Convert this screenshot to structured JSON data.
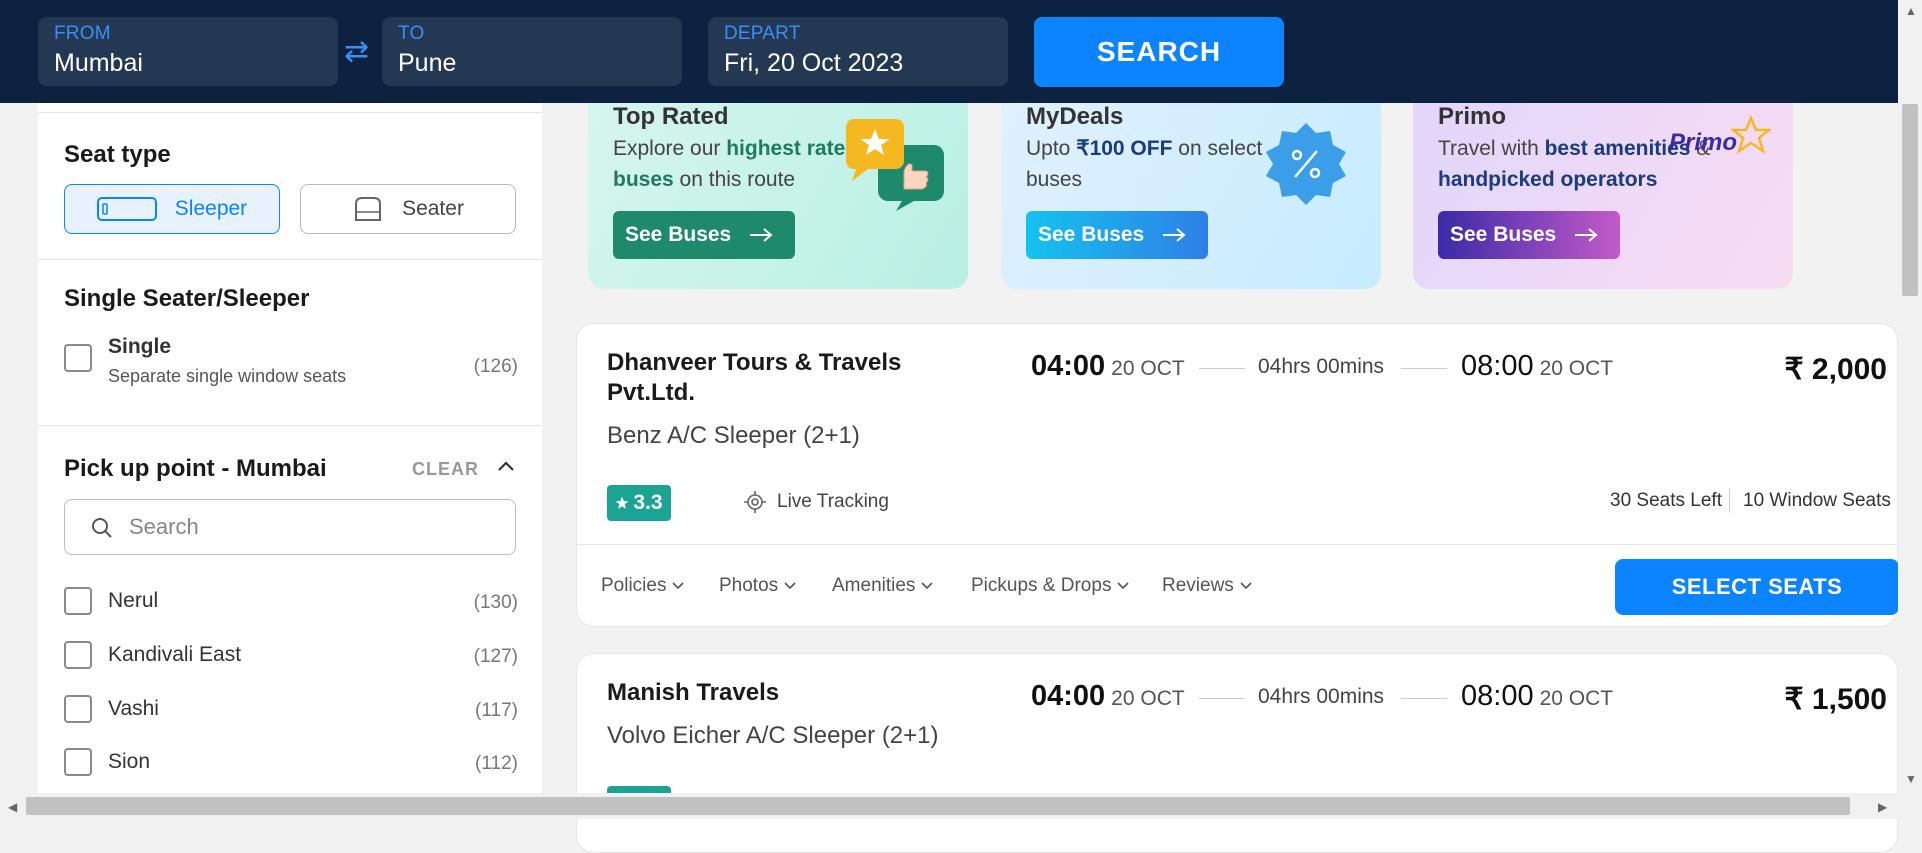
{
  "search": {
    "from_label": "FROM",
    "from_value": "Mumbai",
    "swap_icon": "⇄",
    "to_label": "TO",
    "to_value": "Pune",
    "depart_label": "DEPART",
    "depart_value": "Fri, 20 Oct 2023",
    "button_label": "SEARCH"
  },
  "filters": {
    "seat_type": {
      "title": "Seat type",
      "options": [
        {
          "label": "Sleeper",
          "active": true
        },
        {
          "label": "Seater",
          "active": false
        }
      ]
    },
    "single": {
      "title": "Single Seater/Sleeper",
      "option_label": "Single",
      "option_sub": "Separate single window seats",
      "option_count": "(126)"
    },
    "pickup": {
      "title": "Pick up point - Mumbai",
      "clear_label": "CLEAR",
      "search_placeholder": "Search",
      "items": [
        {
          "label": "Nerul",
          "count": "(130)"
        },
        {
          "label": "Kandivali East",
          "count": "(127)"
        },
        {
          "label": "Vashi",
          "count": "(117)"
        },
        {
          "label": "Sion",
          "count": "(112)"
        }
      ]
    }
  },
  "promos": [
    {
      "title": "Top Rated",
      "desc_pre": "Explore our ",
      "desc_bold": "highest rated buses",
      "desc_post": " on this route",
      "button": "See Buses",
      "color": "#1f8a6b",
      "bg": "#c9f3ea"
    },
    {
      "title": "MyDeals",
      "desc_pre": "Upto ",
      "desc_bold": "₹100 OFF",
      "desc_post": " on select buses",
      "button": "See Buses",
      "color": "#1fb6f0",
      "bg": "#d5eeff"
    },
    {
      "title": "Primo",
      "desc_pre": "Travel with ",
      "desc_bold": "best amenities",
      "desc_mid": " & ",
      "desc_bold2": "handpicked operators",
      "button": "See Buses",
      "logo_text": "Primo",
      "color": "#4b2aa8",
      "bg": "#ead9fb"
    }
  ],
  "buses": [
    {
      "operator": "Dhanveer Tours & Travels Pvt.Ltd.",
      "bus_type": "Benz A/C Sleeper (2+1)",
      "depart_time": "04:00",
      "depart_date": "20 OCT",
      "duration": "04hrs 00mins",
      "arrive_time": "08:00",
      "arrive_date": "20 OCT",
      "price": "₹ 2,000",
      "rating": "3.3",
      "tracking": "Live Tracking",
      "seats_left": "30 Seats Left",
      "window_seats": "10 Window Seats",
      "tabs": [
        "Policies",
        "Photos",
        "Amenities",
        "Pickups & Drops",
        "Reviews"
      ],
      "select_label": "SELECT SEATS"
    },
    {
      "operator": "Manish Travels",
      "bus_type": "Volvo Eicher A/C Sleeper (2+1)",
      "depart_time": "04:00",
      "depart_date": "20 OCT",
      "duration": "04hrs 00mins",
      "arrive_time": "08:00",
      "arrive_date": "20 OCT",
      "price": "₹ 1,500"
    }
  ],
  "colors": {
    "navy": "#0d2141",
    "accent": "#0d84ff",
    "rating": "#1ba393"
  }
}
